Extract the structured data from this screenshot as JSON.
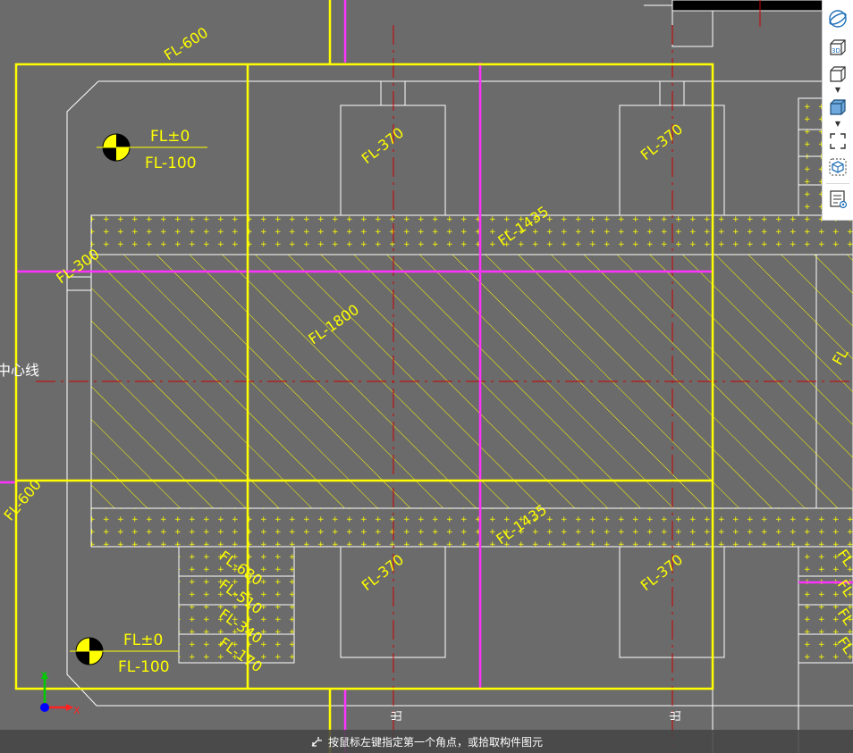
{
  "drawing": {
    "labels": {
      "fl_600_top": "FL-600",
      "fl_600_left": "FL-600",
      "fl_300": "FL-300",
      "fl_1800": "FL-1800",
      "fl_1435_top": "FL-1435",
      "fl_1435_bottom": "FL-1435",
      "fl_370_tl": "FL-370",
      "fl_370_tr": "FL-370",
      "fl_370_bl": "FL-370",
      "fl_370_br": "FL-370",
      "fl_680": "FL-680",
      "fl_510": "FL-510",
      "fl_340": "FL-340",
      "fl_170": "FL-170",
      "fl_right_a": "FL",
      "fl_right_b": "FL",
      "fl_right_c": "FL",
      "fl_right_d": "FL",
      "fl_right_e": "FL",
      "centerline": "中心线"
    },
    "elevation_marks": [
      {
        "upper": "FL±0",
        "lower": "FL-100"
      },
      {
        "upper": "FL±0",
        "lower": "FL-100"
      }
    ],
    "exit_marks": [
      "出",
      "出"
    ],
    "axis": {
      "x": "X",
      "y": "Y"
    },
    "colors": {
      "background": "#6b6b6b",
      "wall": "#ffff00",
      "beam": "#ff33ff",
      "axis_line": "#cc0000",
      "outline": "#ffffff",
      "hatch": "#ffff00"
    }
  },
  "toolbar": {
    "tools": [
      {
        "name": "orbit-icon"
      },
      {
        "name": "view-3d-icon",
        "label": "3D"
      },
      {
        "name": "view-cube-icon"
      },
      {
        "name": "view-solid-cube-icon"
      },
      {
        "name": "zoom-extents-icon"
      },
      {
        "name": "select-component-icon"
      },
      {
        "name": "properties-panel-icon"
      }
    ]
  },
  "status": {
    "prompt": "按鼠标左键指定第一个角点，或拾取构件图元"
  }
}
